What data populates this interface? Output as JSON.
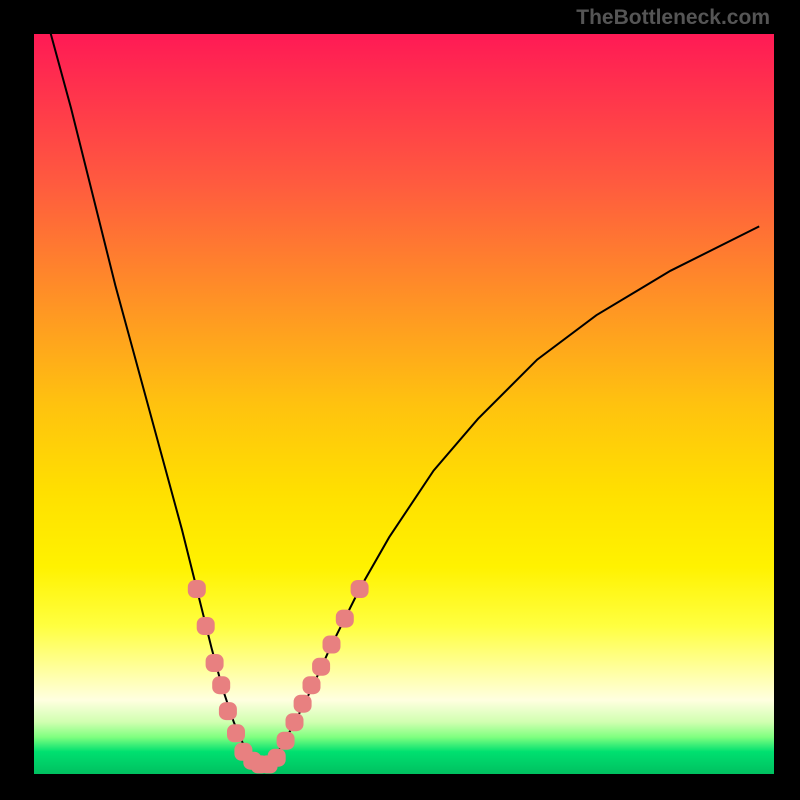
{
  "attribution": "TheBottleneck.com",
  "colors": {
    "marker": "#e88080",
    "curve": "#000000",
    "frame": "#000000"
  },
  "chart_data": {
    "type": "line",
    "title": "",
    "xlabel": "",
    "ylabel": "",
    "xlim": [
      0,
      100
    ],
    "ylim": [
      0,
      100
    ],
    "grid": false,
    "legend": false,
    "annotations": [],
    "series": [
      {
        "name": "bottleneck-curve",
        "x": [
          2,
          5,
          8,
          11,
          14,
          17,
          20,
          22,
          24,
          25.5,
          27,
          28.5,
          30,
          31.5,
          33,
          35,
          37.5,
          40,
          44,
          48,
          54,
          60,
          68,
          76,
          86,
          98
        ],
        "y": [
          101,
          90,
          78,
          66,
          55,
          44,
          33,
          25,
          17,
          11.5,
          7,
          3.5,
          1.5,
          1.5,
          3,
          6.5,
          11.5,
          17,
          25,
          32,
          41,
          48,
          56,
          62,
          68,
          74
        ]
      }
    ],
    "markers": [
      {
        "x": 22.0,
        "y": 25.0
      },
      {
        "x": 23.2,
        "y": 20.0
      },
      {
        "x": 24.4,
        "y": 15.0
      },
      {
        "x": 25.3,
        "y": 12.0
      },
      {
        "x": 26.2,
        "y": 8.5
      },
      {
        "x": 27.3,
        "y": 5.5
      },
      {
        "x": 28.3,
        "y": 3.0
      },
      {
        "x": 29.5,
        "y": 1.8
      },
      {
        "x": 30.5,
        "y": 1.3
      },
      {
        "x": 31.7,
        "y": 1.3
      },
      {
        "x": 32.8,
        "y": 2.2
      },
      {
        "x": 34.0,
        "y": 4.5
      },
      {
        "x": 35.2,
        "y": 7.0
      },
      {
        "x": 36.3,
        "y": 9.5
      },
      {
        "x": 37.5,
        "y": 12.0
      },
      {
        "x": 38.8,
        "y": 14.5
      },
      {
        "x": 40.2,
        "y": 17.5
      },
      {
        "x": 42.0,
        "y": 21.0
      },
      {
        "x": 44.0,
        "y": 25.0
      }
    ]
  }
}
